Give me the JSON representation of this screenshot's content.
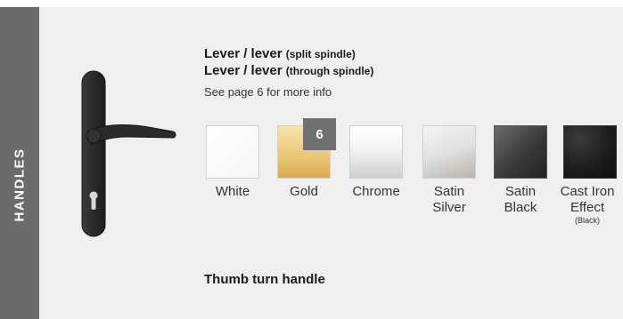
{
  "side_tab": {
    "label": "HANDLES"
  },
  "product": {
    "title_line1": "Lever / lever",
    "title_line1_note": "(split spindle)",
    "title_line2": "Lever / lever",
    "title_line2_note": "(through spindle)",
    "info": "See page 6 for more info"
  },
  "badge": {
    "text": "6",
    "color": "#707070"
  },
  "finishes": [
    {
      "line1": "White",
      "line2": "",
      "note": "",
      "color": "#ffffff"
    },
    {
      "line1": "Gold",
      "line2": "",
      "note": "",
      "color": "#ecc878"
    },
    {
      "line1": "Chrome",
      "line2": "",
      "note": "",
      "color": "#f3f3f3"
    },
    {
      "line1": "Satin",
      "line2": "Silver",
      "note": "",
      "color": "#e0e0e0"
    },
    {
      "line1": "Satin",
      "line2": "Black",
      "note": "",
      "color": "#3a3a3a"
    },
    {
      "line1": "Cast Iron",
      "line2": "Effect",
      "note": "(Black)",
      "color": "#1c1c1c"
    }
  ],
  "thumb_turn": {
    "title": "Thumb turn handle"
  },
  "colors": {
    "side_tab": "#6b6b6b",
    "background": "#efefef",
    "handle": "#2e2e2e"
  }
}
